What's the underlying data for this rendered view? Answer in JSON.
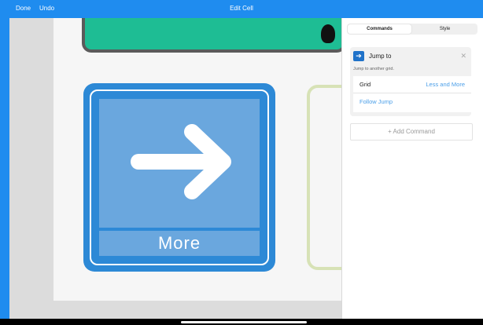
{
  "toolbar": {
    "done_label": "Done",
    "undo_label": "Undo",
    "title": "Edit Cell"
  },
  "grid": {
    "selected_cell_label": "More"
  },
  "panel": {
    "tabs": [
      {
        "label": "Commands",
        "active": true
      },
      {
        "label": "Style",
        "active": false
      }
    ],
    "command": {
      "icon": "arrow-right-icon",
      "title": "Jump to",
      "description": "Jump to another grid.",
      "grid_key": "Grid",
      "grid_value": "Less and More",
      "follow_label": "Follow Jump"
    },
    "add_command_label": "Add Command",
    "add_icon": "+"
  },
  "colors": {
    "accent": "#1f8cef",
    "cell_blue": "#2d89d6",
    "cell_green": "#1ebd94"
  }
}
